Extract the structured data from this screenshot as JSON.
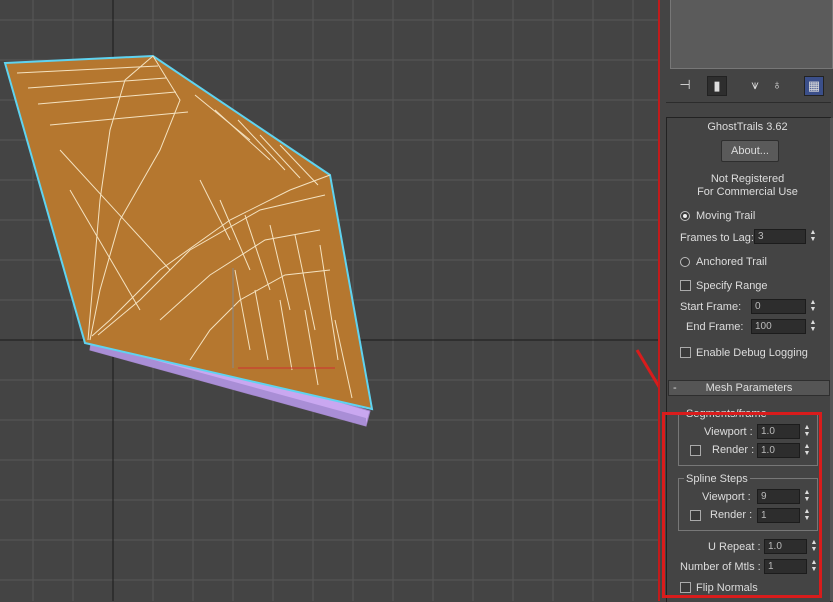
{
  "toolbar": {
    "icons": [
      "pin-stack-icon",
      "show-end-result-icon",
      "make-unique-icon",
      "remove-modifier-icon",
      "configure-modifier-sets-icon"
    ]
  },
  "plugin": {
    "title": "GhostTrails 3.62",
    "about_label": "About...",
    "status_line1": "Not Registered",
    "status_line2": "For Commercial Use",
    "moving_trail_label": "Moving Trail",
    "frames_to_lag_label": "Frames to Lag:",
    "frames_to_lag_value": "3",
    "anchored_trail_label": "Anchored Trail",
    "specify_range_label": "Specify Range",
    "start_frame_label": "Start Frame:",
    "start_frame_value": "0",
    "end_frame_label": "End Frame:",
    "end_frame_value": "100",
    "debug_logging_label": "Enable Debug Logging"
  },
  "mesh_params": {
    "collapse_symbol": "-",
    "title": "Mesh Parameters",
    "segments_group_label": "Segments/frame",
    "seg_viewport_label": "Viewport :",
    "seg_viewport_value": "1.0",
    "seg_render_label": "Render :",
    "seg_render_value": "1.0",
    "spline_group_label": "Spline Steps",
    "spl_viewport_label": "Viewport :",
    "spl_viewport_value": "9",
    "spl_render_label": "Render :",
    "spl_render_value": "1",
    "u_repeat_label": "U Repeat :",
    "u_repeat_value": "1.0",
    "num_mtls_label": "Number of Mtls :",
    "num_mtls_value": "1",
    "flip_normals_label": "Flip Normals"
  },
  "colors": {
    "viewport_bg": "#444444",
    "mesh_fill": "#b5772f",
    "mesh_outline": "#5fd3f0",
    "plane_fill": "#c9a7f0",
    "highlight": "#d91c1c"
  }
}
